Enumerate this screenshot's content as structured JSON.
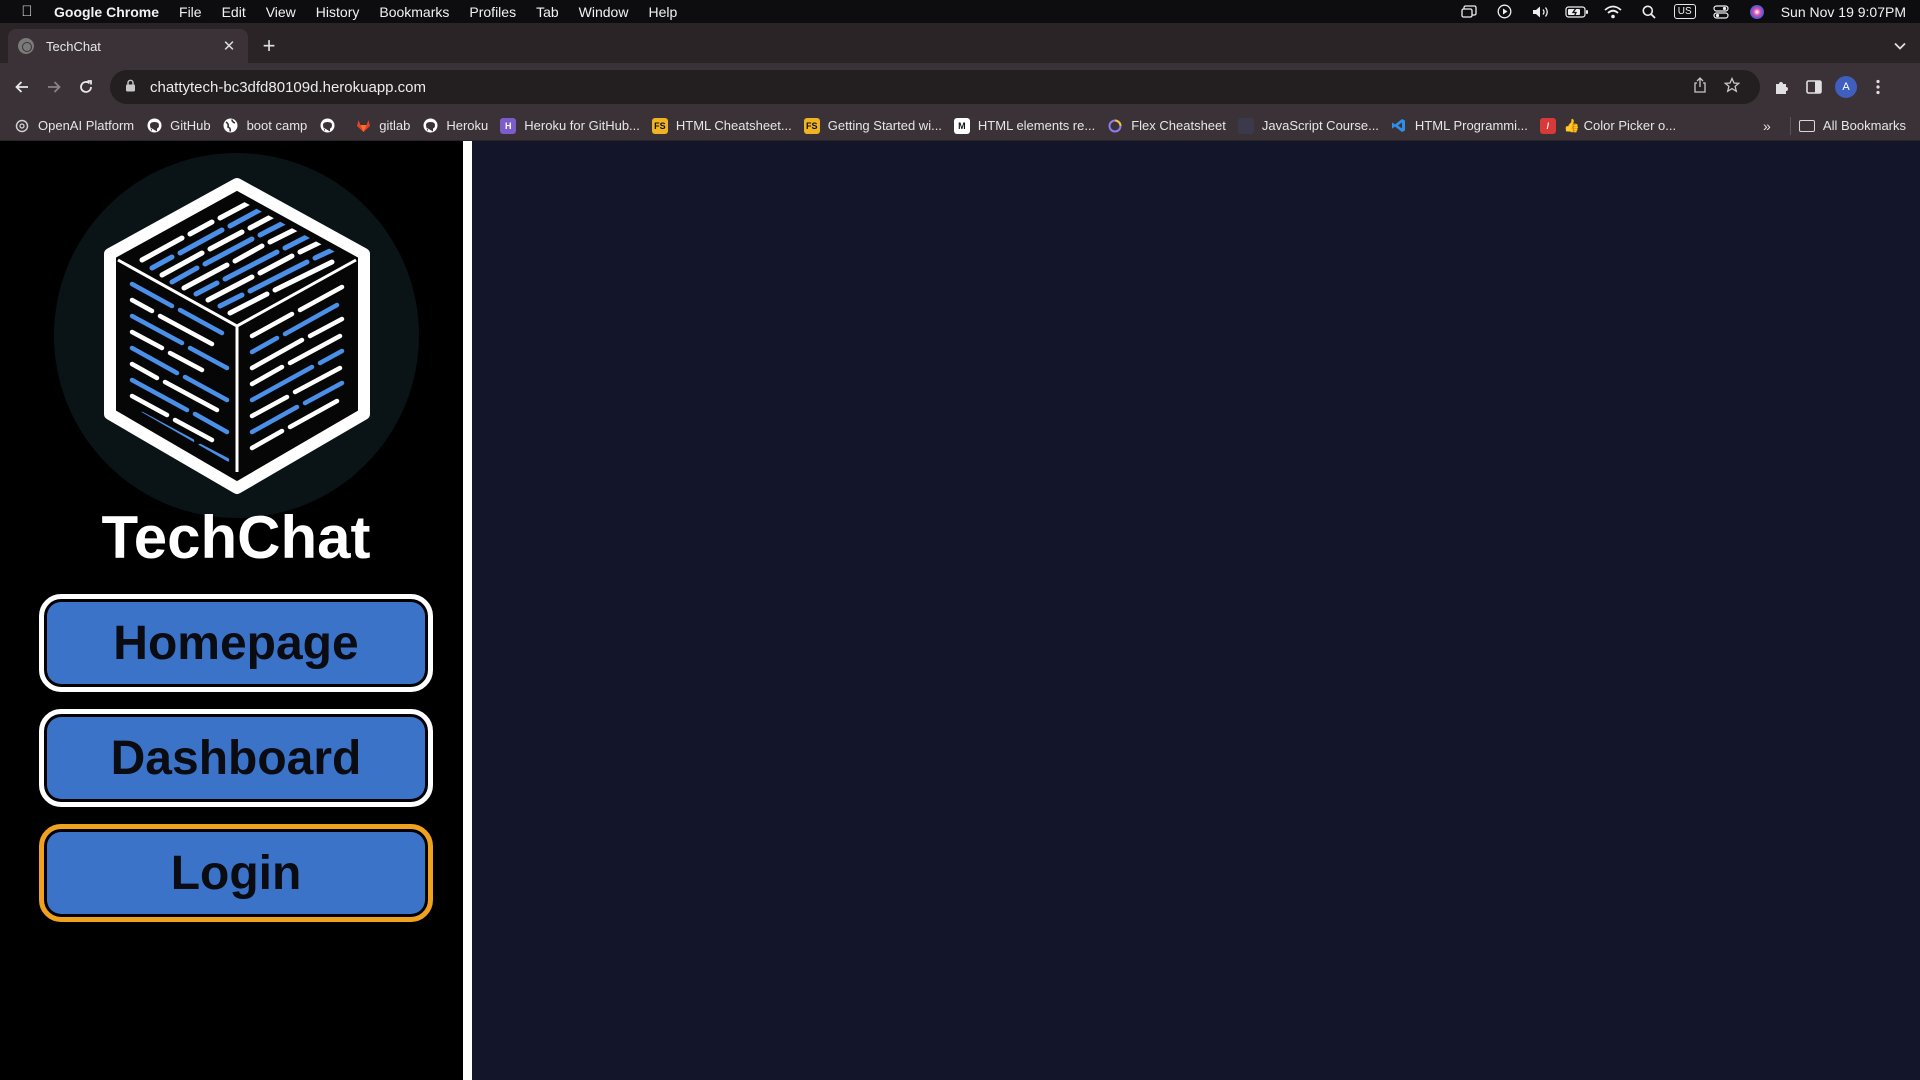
{
  "menubar": {
    "app_name": "Google Chrome",
    "items": [
      "File",
      "Edit",
      "View",
      "History",
      "Bookmarks",
      "Profiles",
      "Tab",
      "Window",
      "Help"
    ],
    "input_source": "US",
    "clock": "Sun Nov 19  9:07PM"
  },
  "browser": {
    "tab_title": "TechChat",
    "url": "chattytech-bc3dfd80109d.herokuapp.com",
    "profile_initial": "A"
  },
  "bookmarks": {
    "items": [
      {
        "label": "OpenAI Platform",
        "icon": "openai-icon",
        "color": "#cfcfcf"
      },
      {
        "label": "GitHub",
        "icon": "github-icon",
        "color": "#ffffff"
      },
      {
        "label": "boot camp",
        "icon": "globe-icon",
        "color": "#ffffff"
      },
      {
        "label": "",
        "icon": "github-icon",
        "color": "#ffffff"
      },
      {
        "label": "gitlab",
        "icon": "gitlab-icon",
        "color": "#e2432a"
      },
      {
        "label": "Heroku",
        "icon": "github-icon",
        "color": "#ffffff"
      },
      {
        "label": "Heroku for GitHub...",
        "icon": "heroku-icon",
        "color": "#7b5cc9"
      },
      {
        "label": "HTML Cheatsheet...",
        "icon": "fs-icon",
        "color": "#f0b323"
      },
      {
        "label": "Getting Started wi...",
        "icon": "fs-icon",
        "color": "#f0b323"
      },
      {
        "label": "HTML elements re...",
        "icon": "mdn-icon",
        "color": "#ffffff"
      },
      {
        "label": "Flex Cheatsheet",
        "icon": "flex-icon",
        "color": "#8f7cf0"
      },
      {
        "label": "JavaScript Course...",
        "icon": "doc-icon",
        "color": "#3a3a4a"
      },
      {
        "label": "HTML Programmi...",
        "icon": "vscode-icon",
        "color": "#2f8fe6"
      },
      {
        "label": "👍 Color Picker o...",
        "icon": "picker-icon",
        "color": "#d83a3a"
      }
    ],
    "more": "»",
    "all_bookmarks": "All Bookmarks"
  },
  "app": {
    "title": "TechChat",
    "nav": [
      {
        "label": "Homepage",
        "active": false
      },
      {
        "label": "Dashboard",
        "active": false
      },
      {
        "label": "Login",
        "active": true
      }
    ],
    "colors": {
      "sidebar_bg": "#000000",
      "main_bg": "#13152a",
      "button_bg": "#3b73c8",
      "button_border": "#ffffff",
      "active_border": "#f0a21e"
    }
  }
}
